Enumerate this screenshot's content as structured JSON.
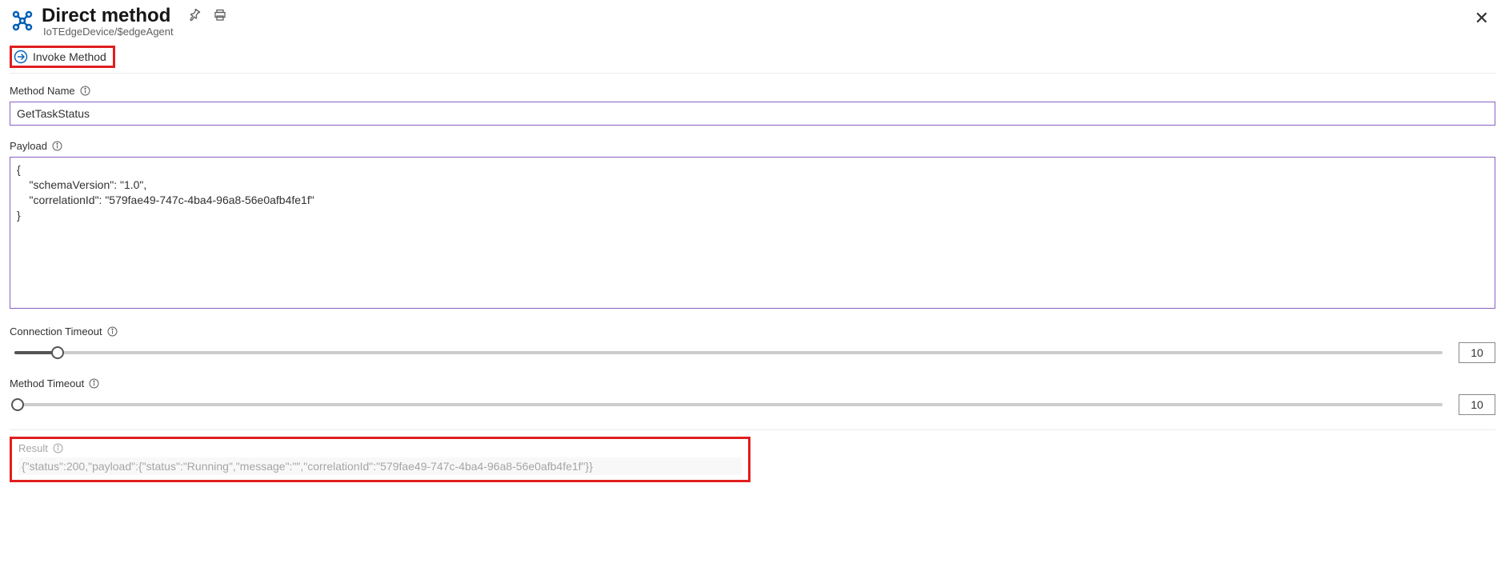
{
  "header": {
    "title": "Direct method",
    "subtitle": "IoTEdgeDevice/$edgeAgent"
  },
  "toolbar": {
    "invoke_label": "Invoke Method"
  },
  "form": {
    "method_name_label": "Method Name",
    "method_name_value": "GetTaskStatus",
    "payload_label": "Payload",
    "payload_value": "{\n    \"schemaVersion\": \"1.0\",\n    \"correlationId\": \"579fae49-747c-4ba4-96a8-56e0afb4fe1f\"\n}",
    "connection_timeout_label": "Connection Timeout",
    "connection_timeout_value": "10",
    "method_timeout_label": "Method Timeout",
    "method_timeout_value": "10"
  },
  "result": {
    "label": "Result",
    "value": "{\"status\":200,\"payload\":{\"status\":\"Running\",\"message\":\"\",\"correlationId\":\"579fae49-747c-4ba4-96a8-56e0afb4fe1f\"}}"
  }
}
